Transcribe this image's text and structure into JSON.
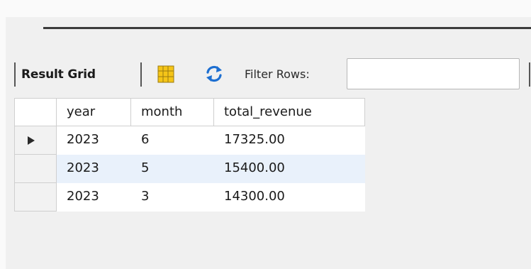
{
  "toolbar": {
    "result_grid_label": "Result Grid",
    "filter_label": "Filter Rows:",
    "filter_value": ""
  },
  "grid": {
    "columns": [
      "year",
      "month",
      "total_revenue"
    ],
    "rows": [
      {
        "year": "2023",
        "month": "6",
        "total_revenue": "17325.00",
        "current": true
      },
      {
        "year": "2023",
        "month": "5",
        "total_revenue": "15400.00",
        "current": false
      },
      {
        "year": "2023",
        "month": "3",
        "total_revenue": "14300.00",
        "current": false
      }
    ]
  },
  "colors": {
    "alt_row": "#e9f1fb",
    "icon_yellow": "#f5c518",
    "icon_blue": "#1d6fd1"
  },
  "icons": [
    "grid-layout-icon",
    "refresh-icon",
    "current-row-arrow-icon"
  ]
}
